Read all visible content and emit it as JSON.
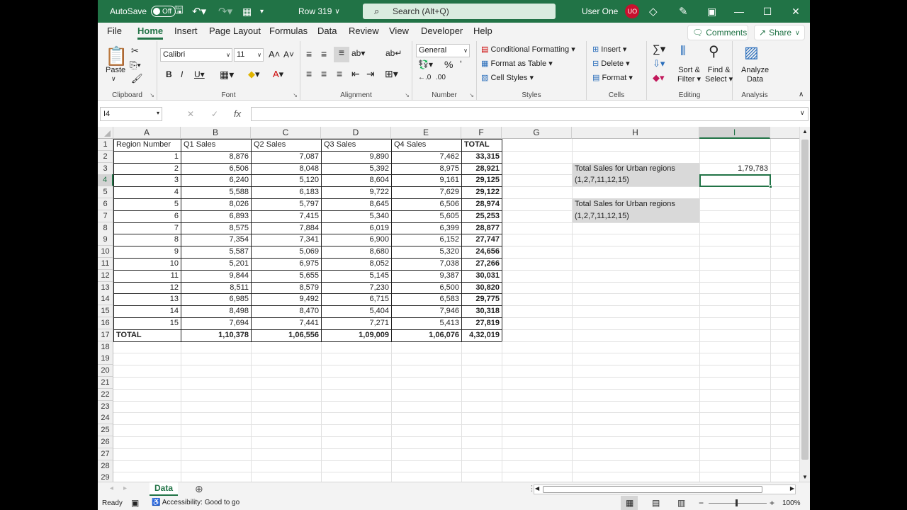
{
  "titlebar": {
    "autosave": "AutoSave",
    "toggle": "Off",
    "doc_title": "Row 319",
    "search": "Search (Alt+Q)",
    "user": "User One",
    "initials": "UO"
  },
  "menu": {
    "items": [
      "File",
      "Home",
      "Insert",
      "Page Layout",
      "Formulas",
      "Data",
      "Review",
      "View",
      "Developer",
      "Help"
    ],
    "comments": "Comments",
    "share": "Share"
  },
  "ribbon": {
    "clipboard": {
      "label": "Clipboard",
      "paste": "Paste"
    },
    "font": {
      "label": "Font",
      "name": "Calibri",
      "size": "11"
    },
    "alignment": {
      "label": "Alignment"
    },
    "number": {
      "label": "Number",
      "format": "General"
    },
    "styles": {
      "label": "Styles",
      "conditional": "Conditional Formatting",
      "format_table": "Format as Table",
      "cell_styles": "Cell Styles"
    },
    "cells": {
      "label": "Cells",
      "insert": "Insert",
      "delete": "Delete",
      "format": "Format"
    },
    "editing": {
      "label": "Editing",
      "sort": "Sort &",
      "sort2": "Filter",
      "find": "Find &",
      "find2": "Select"
    },
    "analysis": {
      "label": "Analysis",
      "analyze": "Analyze",
      "analyze2": "Data"
    }
  },
  "formula_bar": {
    "name_box": "I4",
    "fx": "fx",
    "formula": ""
  },
  "columns": [
    "A",
    "B",
    "C",
    "D",
    "E",
    "F",
    "G",
    "H",
    "I"
  ],
  "selected_column": "I",
  "selected_row": 4,
  "headers": [
    "Region Number",
    "Q1 Sales",
    "Q2 Sales",
    "Q3 Sales",
    "Q4 Sales",
    "TOTAL"
  ],
  "rows": [
    [
      "1",
      "8,876",
      "7,087",
      "9,890",
      "7,462",
      "33,315"
    ],
    [
      "2",
      "6,506",
      "8,048",
      "5,392",
      "8,975",
      "28,921"
    ],
    [
      "3",
      "6,240",
      "5,120",
      "8,604",
      "9,161",
      "29,125"
    ],
    [
      "4",
      "5,588",
      "6,183",
      "9,722",
      "7,629",
      "29,122"
    ],
    [
      "5",
      "8,026",
      "5,797",
      "8,645",
      "6,506",
      "28,974"
    ],
    [
      "6",
      "6,893",
      "7,415",
      "5,340",
      "5,605",
      "25,253"
    ],
    [
      "7",
      "8,575",
      "7,884",
      "6,019",
      "6,399",
      "28,877"
    ],
    [
      "8",
      "7,354",
      "7,341",
      "6,900",
      "6,152",
      "27,747"
    ],
    [
      "9",
      "5,587",
      "5,069",
      "8,680",
      "5,320",
      "24,656"
    ],
    [
      "10",
      "5,201",
      "6,975",
      "8,052",
      "7,038",
      "27,266"
    ],
    [
      "11",
      "9,844",
      "5,655",
      "5,145",
      "9,387",
      "30,031"
    ],
    [
      "12",
      "8,511",
      "8,579",
      "7,230",
      "6,500",
      "30,820"
    ],
    [
      "13",
      "6,985",
      "9,492",
      "6,715",
      "6,583",
      "29,775"
    ],
    [
      "14",
      "8,498",
      "8,470",
      "5,404",
      "7,946",
      "30,318"
    ],
    [
      "15",
      "7,694",
      "7,441",
      "7,271",
      "5,413",
      "27,819"
    ]
  ],
  "total_row": [
    "TOTAL",
    "1,10,378",
    "1,06,556",
    "1,09,009",
    "1,06,076",
    "4,32,019"
  ],
  "side": {
    "label1_line1": "Total Sales for Urban regions",
    "label1_line2": "(1,2,7,11,12,15)",
    "value1": "1,79,783",
    "label2_line1": "Total Sales for Urban regions",
    "label2_line2": "(1,2,7,11,12,15)"
  },
  "sheet_tab": "Data",
  "status": {
    "ready": "Ready",
    "accessibility": "Accessibility: Good to go",
    "zoom": "100%"
  },
  "colors": {
    "accent": "#217346"
  }
}
